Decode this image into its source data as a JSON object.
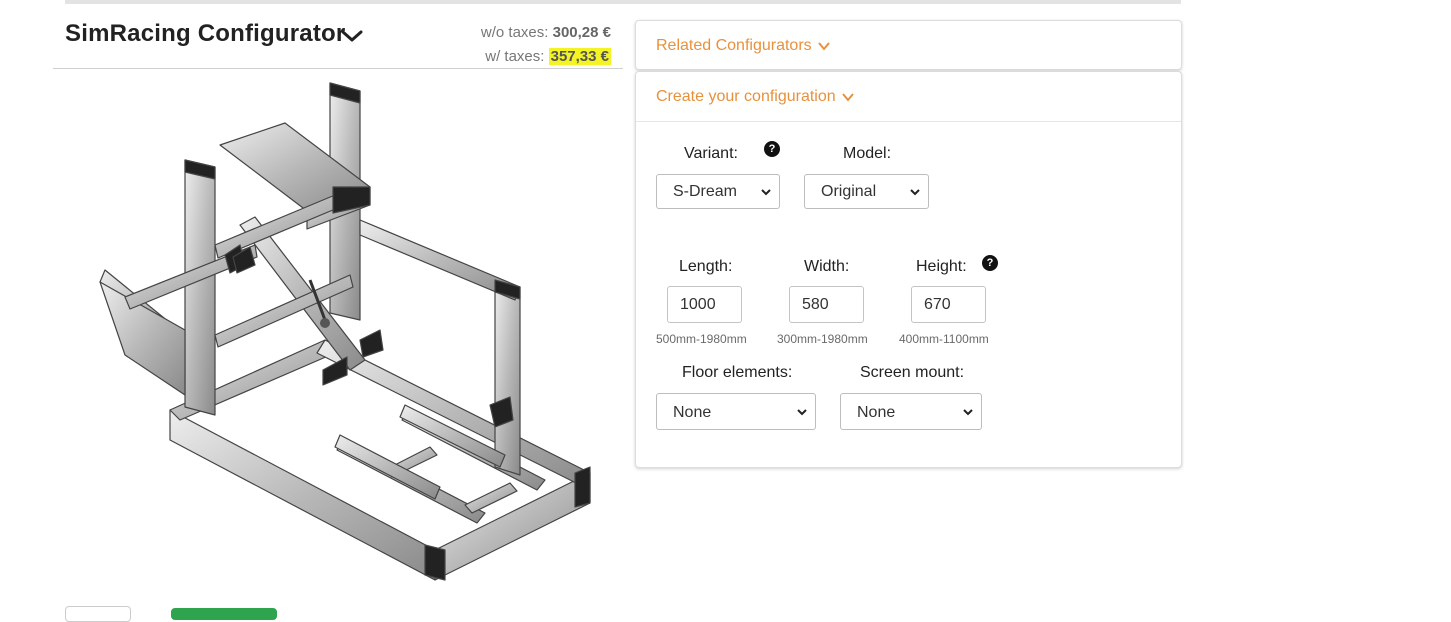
{
  "header": {
    "title": "SimRacing Configurator",
    "price_without_taxes_label": "w/o taxes:",
    "price_without_taxes": "300,28 €",
    "price_with_taxes_label": "w/ taxes:",
    "price_with_taxes": "357,33 €",
    "highlight_color": "#f4f425"
  },
  "related": {
    "label": "Related Configurators"
  },
  "config": {
    "label": "Create your configuration",
    "accent_color": "#e8913c",
    "variant": {
      "label": "Variant:",
      "value": "S-Dream"
    },
    "model": {
      "label": "Model:",
      "value": "Original"
    },
    "length": {
      "label": "Length:",
      "value": "1000",
      "hint": "500mm-1980mm"
    },
    "width": {
      "label": "Width:",
      "value": "580",
      "hint": "300mm-1980mm"
    },
    "height": {
      "label": "Height:",
      "value": "670",
      "hint": "400mm-1100mm"
    },
    "floor_elements": {
      "label": "Floor elements:",
      "value": "None"
    },
    "screen_mount": {
      "label": "Screen mount:",
      "value": "None"
    },
    "help_glyph": "?"
  }
}
